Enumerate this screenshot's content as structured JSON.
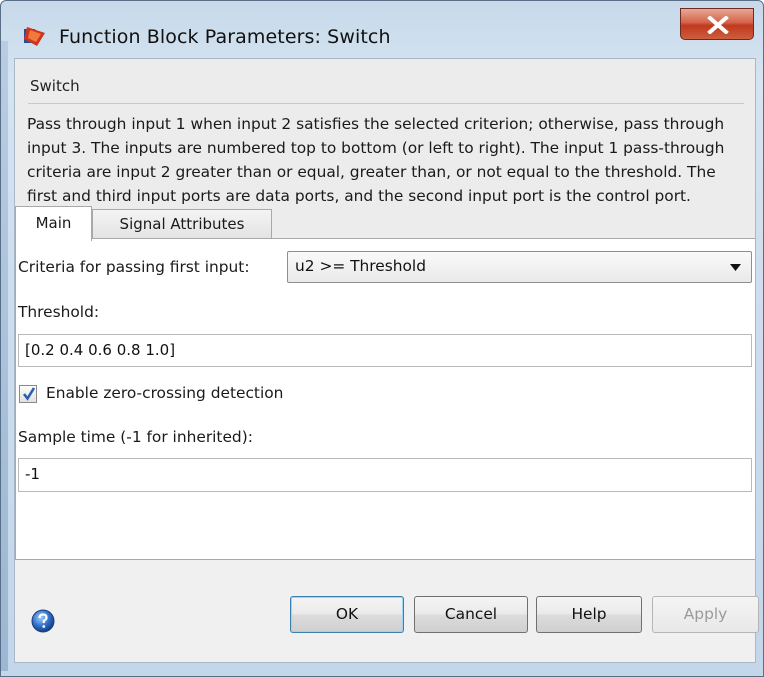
{
  "window": {
    "title": "Function Block Parameters: Switch"
  },
  "group": {
    "title": "Switch",
    "description": "Pass through input 1 when input 2 satisfies the selected criterion; otherwise, pass through input 3.  The inputs are numbered top to bottom (or left to right). The input 1 pass-through criteria are input 2 greater than or equal, greater than, or not equal to the threshold.  The first and third input ports are data ports, and the second input port is the control port."
  },
  "tabs": [
    {
      "label": "Main",
      "selected": true
    },
    {
      "label": "Signal Attributes",
      "selected": false
    }
  ],
  "form": {
    "criteria_label": "Criteria for passing first input:",
    "criteria_value": "u2 >= Threshold",
    "threshold_label": "Threshold:",
    "threshold_value": "[0.2 0.4 0.6 0.8 1.0]",
    "zero_crossing_label": "Enable zero-crossing detection",
    "zero_crossing_checked": true,
    "sample_time_label": "Sample time (-1 for inherited):",
    "sample_time_value": "-1"
  },
  "buttons": {
    "ok": "OK",
    "cancel": "Cancel",
    "help": "Help",
    "apply": "Apply"
  },
  "icons": {
    "app": "simulink-block-icon",
    "close": "close-icon",
    "help": "help-icon",
    "dropdown": "chevron-down-icon",
    "check": "check-icon"
  },
  "colors": {
    "close_button": "#c7432a",
    "ok_focus_border": "#3c7fb1",
    "title_bar": "#c7d9ea"
  }
}
